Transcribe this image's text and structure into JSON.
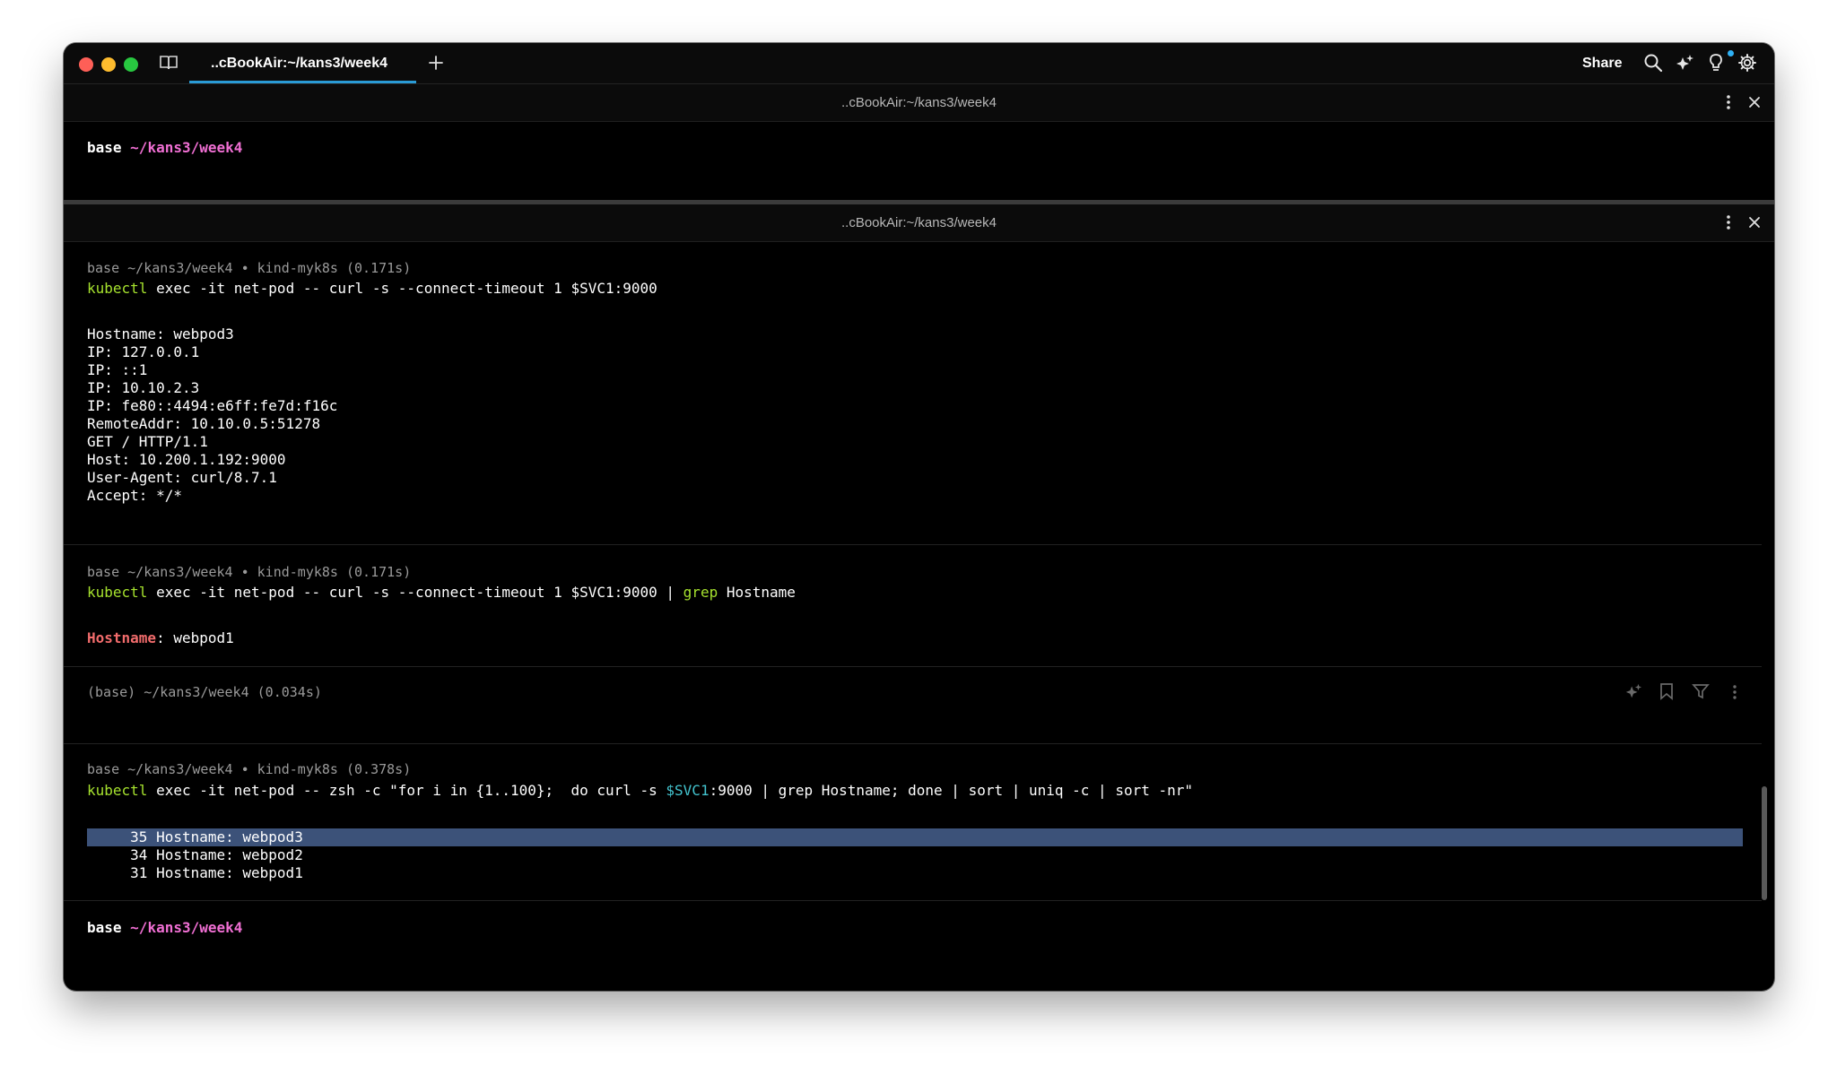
{
  "window": {
    "tab_title": "..cBookAir:~/kans3/week4",
    "share_label": "Share",
    "icons": [
      "book-icon",
      "plus-icon",
      "search-icon",
      "ai-sparkle-icon",
      "lightbulb-icon",
      "gear-icon"
    ]
  },
  "panes": {
    "top": {
      "title": "..cBookAir:~/kans3/week4",
      "prompt_base": "base",
      "prompt_path": "~/kans3/week4"
    },
    "bottom": {
      "title": "..cBookAir:~/kans3/week4"
    }
  },
  "blocks": [
    {
      "meta": "base ~/kans3/week4 ∙ kind-myk8s (0.171s)",
      "cmd_kw": "kubectl",
      "cmd_rest": " exec -it net-pod -- curl -s --connect-timeout 1 $SVC1:9000",
      "output": "Hostname: webpod3\nIP: 127.0.0.1\nIP: ::1\nIP: 10.10.2.3\nIP: fe80::4494:e6ff:fe7d:f16c\nRemoteAddr: 10.10.0.5:51278\nGET / HTTP/1.1\nHost: 10.200.1.192:9000\nUser-Agent: curl/8.7.1\nAccept: */*"
    },
    {
      "meta": "base ~/kans3/week4 ∙ kind-myk8s (0.171s)",
      "cmd_kw": "kubectl",
      "cmd_mid": " exec -it net-pod -- curl -s --connect-timeout 1 $SVC1:9000 | ",
      "cmd_kw2": "grep",
      "cmd_end": " Hostname",
      "out_key": "Hostname",
      "out_rest": ": webpod1"
    },
    {
      "meta": "(base) ~/kans3/week4 (0.034s)"
    },
    {
      "meta": "base ~/kans3/week4 ∙ kind-myk8s (0.378s)",
      "cmd_kw": "kubectl",
      "cmd_a": " exec -it net-pod -- zsh -c \"for i in {1..100};  do curl -s ",
      "cmd_var": "$SVC1",
      "cmd_b": ":9000 | grep Hostname; done | sort | uniq -c | sort -nr\"",
      "results": [
        "     35 Hostname: webpod3",
        "     34 Hostname: webpod2",
        "     31 Hostname: webpod1"
      ]
    }
  ],
  "final_prompt": {
    "base": "base",
    "path": "~/kans3/week4"
  },
  "colors": {
    "accent": "#2a9bd6",
    "command_keyword": "#a6e22e",
    "path": "#f06fd3",
    "variable": "#43c4cf",
    "highlight_key": "#f26c6c",
    "selection": "#3c5279"
  }
}
